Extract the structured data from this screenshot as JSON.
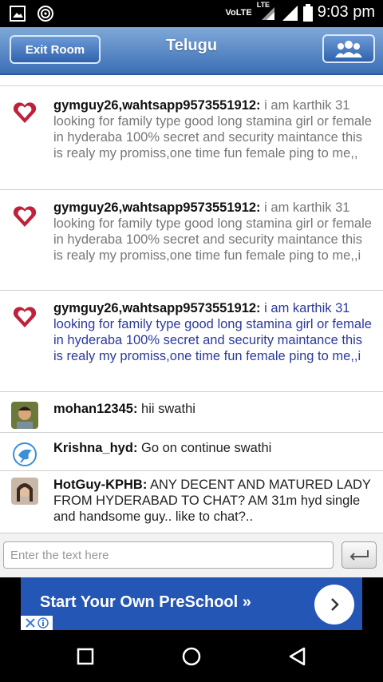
{
  "status_bar": {
    "network_label": "VoLTE",
    "lte_label": "LTE",
    "time": "9:03 pm"
  },
  "header": {
    "exit_label": "Exit Room",
    "title": "Telugu"
  },
  "messages": [
    {
      "user": "gymguy26,wahtsapp9573551912:",
      "text": " i am karthik 31 looking for family type good long stamina girl or female in hyderaba 100%  secret and security maintance this is realy my promiss,one time fun female ping to me,,",
      "avatar": "heart-avatar-icon"
    },
    {
      "user": "gymguy26,wahtsapp9573551912:",
      "text": " i am karthik 31 looking for family type good long stamina girl or female in hyderaba 100%  secret and security maintance this is realy my promiss,one time fun female ping to me,,i",
      "avatar": "heart-avatar-icon"
    },
    {
      "user": "gymguy26,wahtsapp9573551912:",
      "text": " i am karthik 31 looking for family type good long stamina girl or female in hyderaba 100%  secret and security maintance this is realy my promiss,one time fun female ping to me,,i",
      "avatar": "heart-avatar-icon"
    },
    {
      "user": "mohan12345:",
      "text": " hii swathi",
      "avatar": "photo-avatar-icon"
    },
    {
      "user": "Krishna_hyd:",
      "text": " Go on continue swathi",
      "avatar": "bird-avatar-icon"
    },
    {
      "user": "HotGuy-KPHB:",
      "text": " ANY DECENT AND MATURED LADY FROM HYDERABAD TO CHAT? AM 31m hyd single and handsome guy.. like to chat?..",
      "avatar": "photo-avatar-icon"
    }
  ],
  "input": {
    "placeholder": "Enter the text here"
  },
  "ad": {
    "text": "Start Your Own PreSchool »"
  },
  "colors": {
    "header_blue": "#3c6fb5",
    "highlight_text": "#2b3a9e",
    "ad_blue": "#2456b5"
  }
}
